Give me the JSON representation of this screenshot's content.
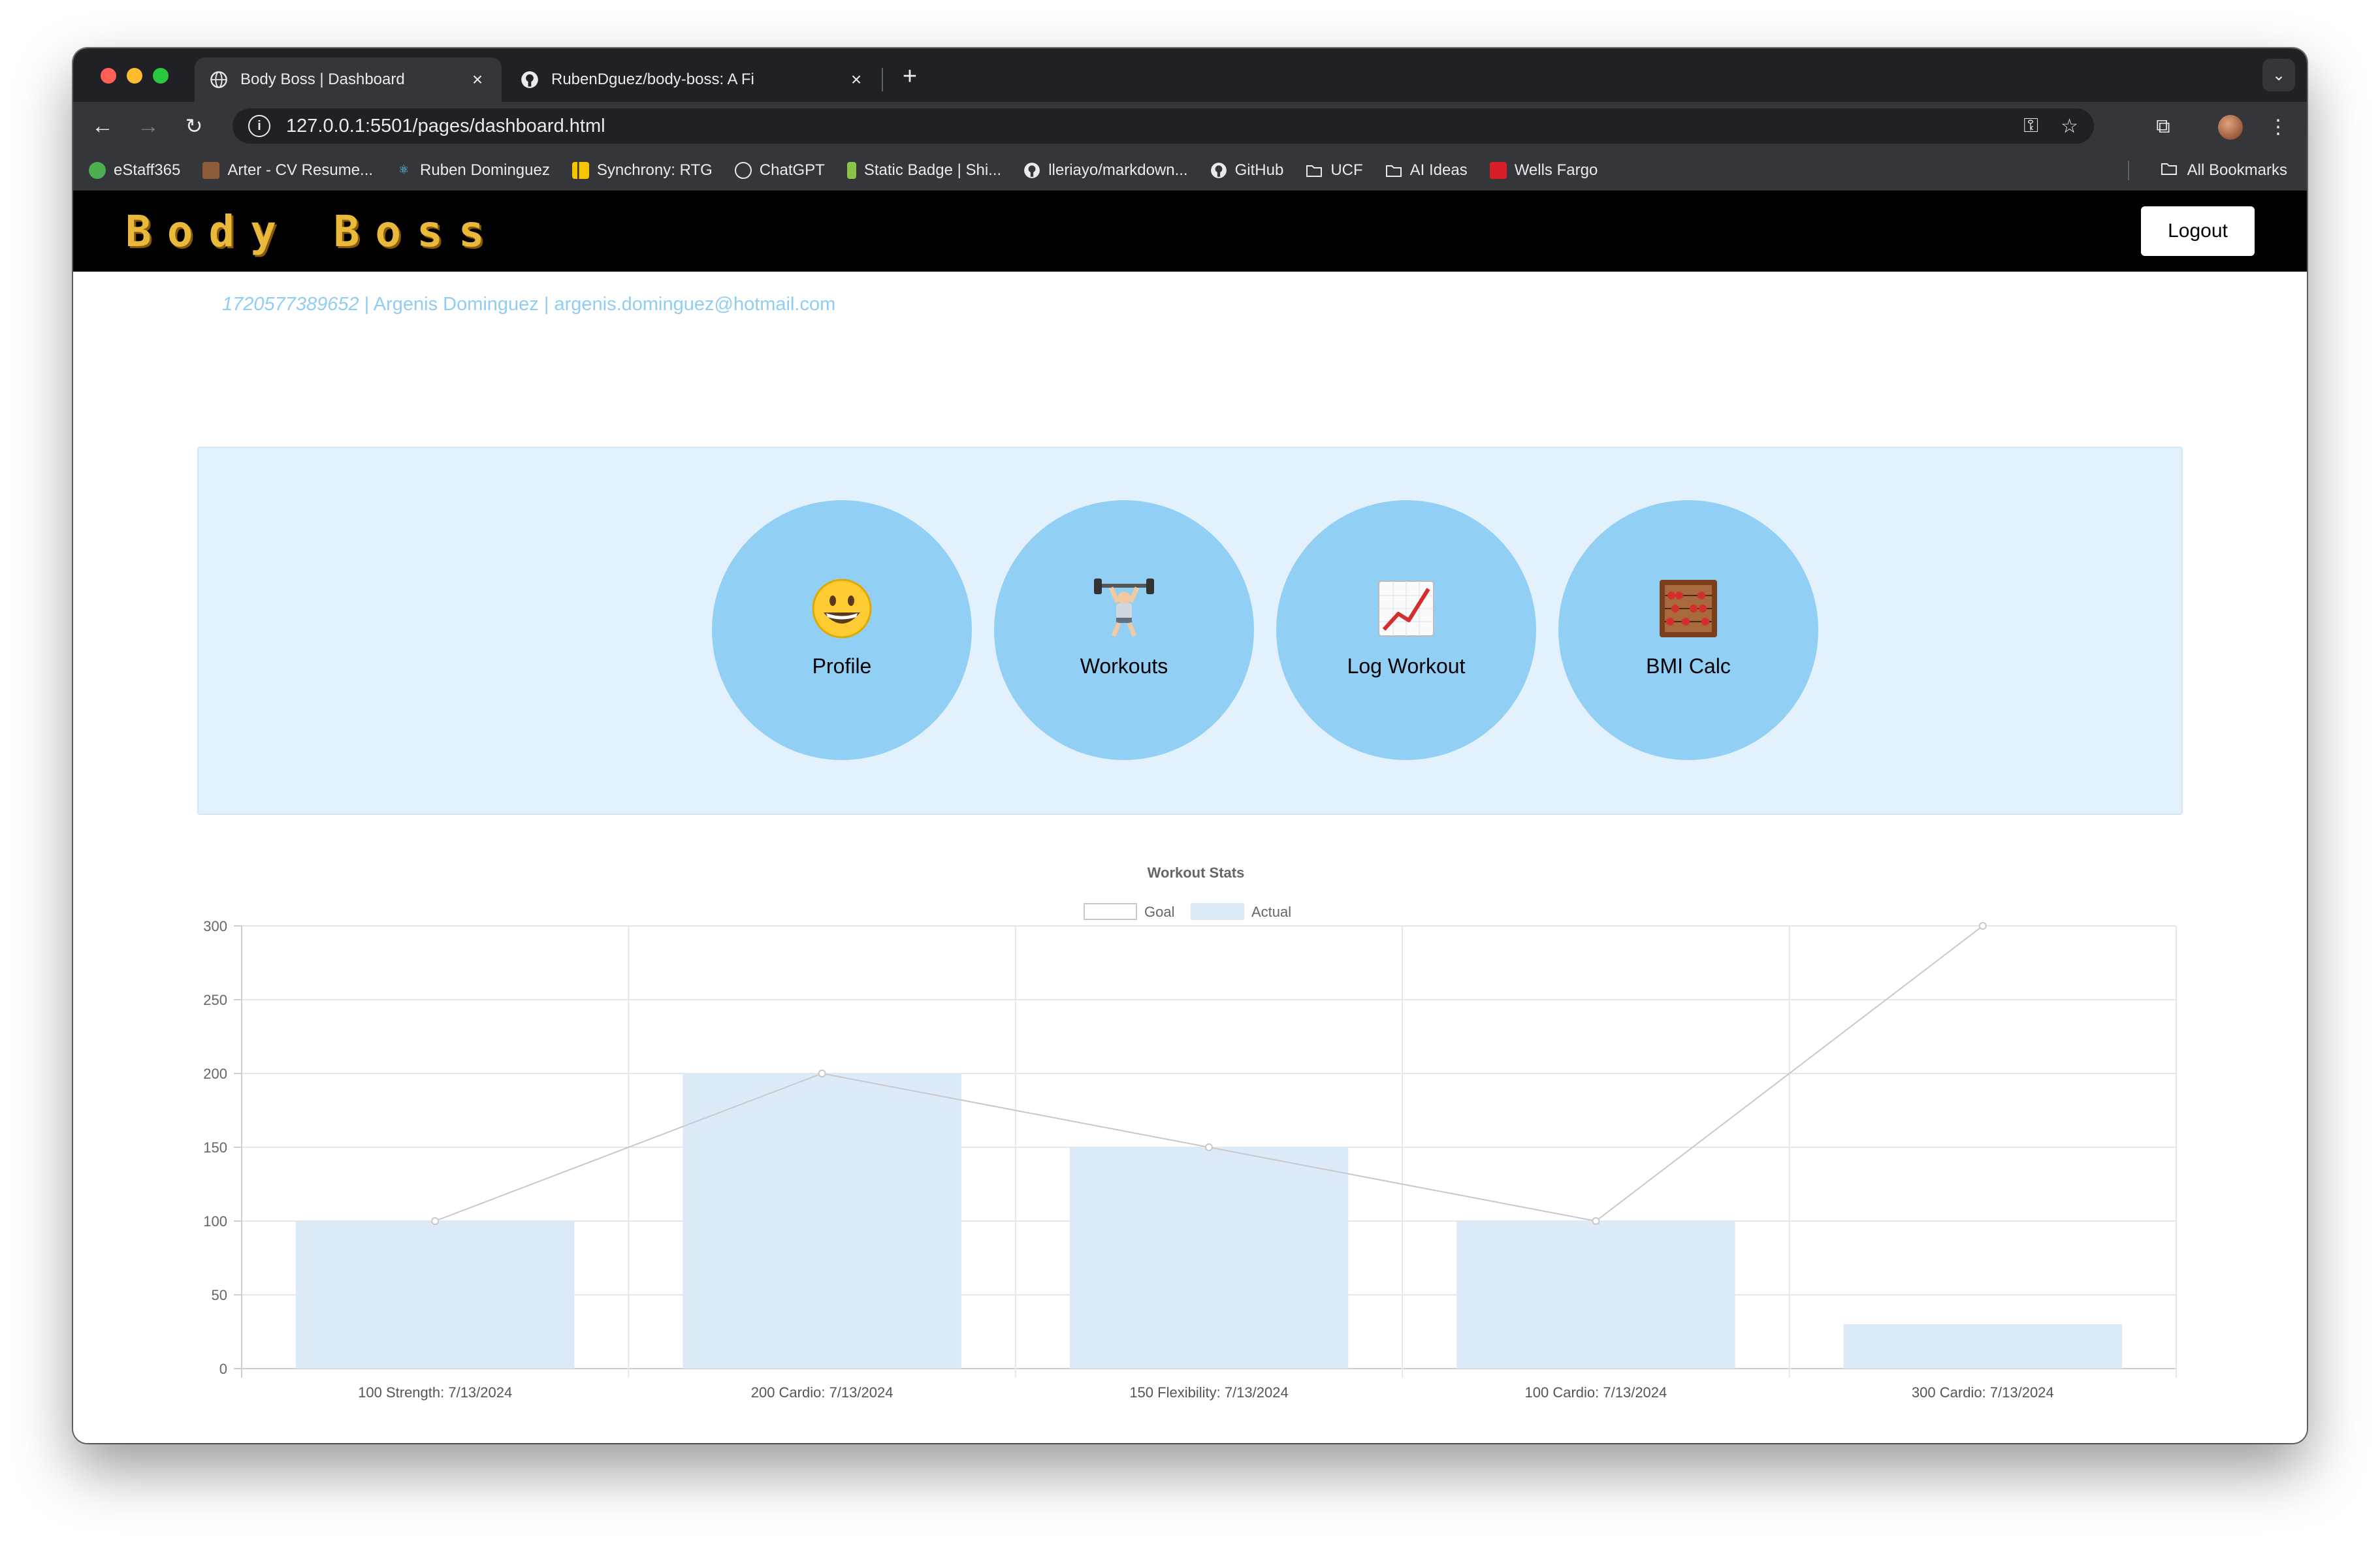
{
  "browser": {
    "tabs": [
      {
        "label": "Body Boss | Dashboard",
        "icon": "globe-icon",
        "active": true
      },
      {
        "label": "RubenDguez/body-boss: A Fi",
        "icon": "github-icon",
        "active": false
      }
    ],
    "url": "127.0.0.1:5501/pages/dashboard.html",
    "bookmarks": [
      {
        "label": "eStaff365",
        "icon": "estaff-icon",
        "color": "#4caf50"
      },
      {
        "label": "Arter - CV Resume...",
        "icon": "arter-icon",
        "color": "#8d5b3a"
      },
      {
        "label": "Ruben Dominguez",
        "icon": "react-icon",
        "color": "#61dafb"
      },
      {
        "label": "Synchrony: RTG",
        "icon": "synchrony-icon",
        "color": "#f7c400"
      },
      {
        "label": "ChatGPT",
        "icon": "chatgpt-icon",
        "color": "#ffffff"
      },
      {
        "label": "Static Badge | Shi...",
        "icon": "badge-icon",
        "color": "#8bc34a"
      },
      {
        "label": "lleriayo/markdown...",
        "icon": "github-icon",
        "color": "#ffffff"
      },
      {
        "label": "GitHub",
        "icon": "github-icon",
        "color": "#ffffff"
      },
      {
        "label": "UCF",
        "icon": "folder-icon",
        "color": "#e8eaed"
      },
      {
        "label": "AI Ideas",
        "icon": "folder-icon",
        "color": "#e8eaed"
      },
      {
        "label": "Wells Fargo",
        "icon": "wellsfargo-icon",
        "color": "#d71e28"
      }
    ],
    "all_bookmarks": "All Bookmarks"
  },
  "header": {
    "brand": "Body Boss",
    "logout": "Logout"
  },
  "user": {
    "id": "1720577389652",
    "separator1": " | ",
    "name": "Argenis Dominguez",
    "separator2": " | ",
    "email": "argenis.dominguez@hotmail.com"
  },
  "tiles": [
    {
      "label": "Profile",
      "icon": "grinning-face-icon"
    },
    {
      "label": "Workouts",
      "icon": "weightlifter-icon"
    },
    {
      "label": "Log Workout",
      "icon": "chart-increasing-icon"
    },
    {
      "label": "BMI Calc",
      "icon": "abacus-icon"
    }
  ],
  "chart_data": {
    "type": "bar",
    "title": "Workout Stats",
    "categories": [
      "100 Strength: 7/13/2024",
      "200 Cardio: 7/13/2024",
      "150 Flexibility: 7/13/2024",
      "100 Cardio: 7/13/2024",
      "300 Cardio: 7/13/2024"
    ],
    "series": [
      {
        "name": "Goal",
        "type": "line",
        "values": [
          100,
          200,
          150,
          100,
          300
        ],
        "color": "#c8c8c8"
      },
      {
        "name": "Actual",
        "type": "bar",
        "values": [
          100,
          200,
          150,
          100,
          30
        ],
        "color": "#dceaf8"
      }
    ],
    "ylim": [
      0,
      300
    ],
    "yticks": [
      0,
      50,
      100,
      150,
      200,
      250,
      300
    ],
    "grid": true,
    "legend": "top-center"
  }
}
